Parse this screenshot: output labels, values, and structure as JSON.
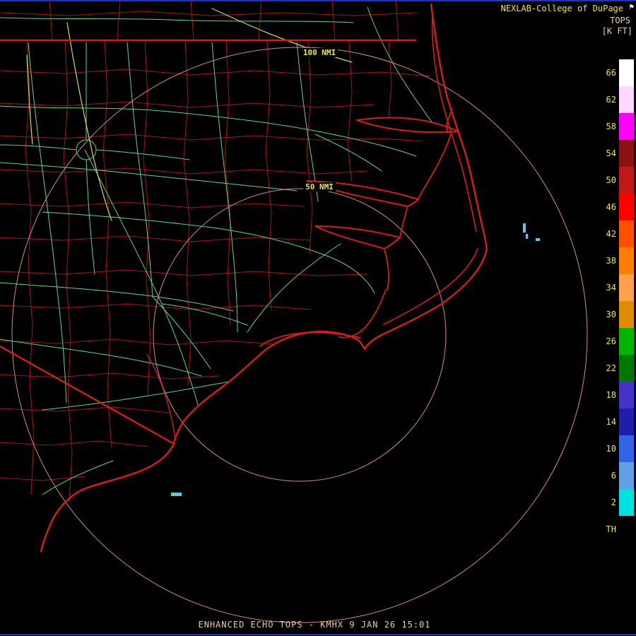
{
  "attribution": {
    "text": "NEXLAB-College of DuPage",
    "logo_icon": "flag-icon"
  },
  "legend": {
    "title": "TOPS",
    "units": "[K FT]",
    "items": [
      {
        "label": "66",
        "color": "#ffffff"
      },
      {
        "label": "62",
        "color": "#ffd7ff"
      },
      {
        "label": "58",
        "color": "#ff00ff"
      },
      {
        "label": "54",
        "color": "#8c1111"
      },
      {
        "label": "50",
        "color": "#c01818"
      },
      {
        "label": "46",
        "color": "#ff0000"
      },
      {
        "label": "42",
        "color": "#ff5000"
      },
      {
        "label": "38",
        "color": "#ff7d00"
      },
      {
        "label": "34",
        "color": "#ffa04b"
      },
      {
        "label": "30",
        "color": "#e08c00"
      },
      {
        "label": "26",
        "color": "#00b400"
      },
      {
        "label": "22",
        "color": "#007800"
      },
      {
        "label": "18",
        "color": "#4632c8"
      },
      {
        "label": "14",
        "color": "#1e1eaa"
      },
      {
        "label": "10",
        "color": "#3264e6"
      },
      {
        "label": "6",
        "color": "#64a0e6"
      },
      {
        "label": "2",
        "color": "#00e1e1"
      },
      {
        "label": "TH",
        "color": "#000000"
      }
    ]
  },
  "rings": {
    "outer_label": "100 NMI",
    "inner_label": "50 NMI"
  },
  "product": {
    "caption": "ENHANCED ECHO TOPS - KMHX 9 JAN 26 15:01",
    "name": "ENHANCED ECHO TOPS",
    "station": "KMHX",
    "datetime": "9 JAN 26 15:01"
  },
  "colors": {
    "coastline": "#d81c1c",
    "county_borders": "#aa1616",
    "roads": "#5fd393",
    "highways": "#d8d855",
    "range_rings": "#d09080",
    "echo": "#58c8e8",
    "frame_line": "#2233bb",
    "label_yellow": "#f0e24a",
    "label_tan": "#e6d49a"
  }
}
